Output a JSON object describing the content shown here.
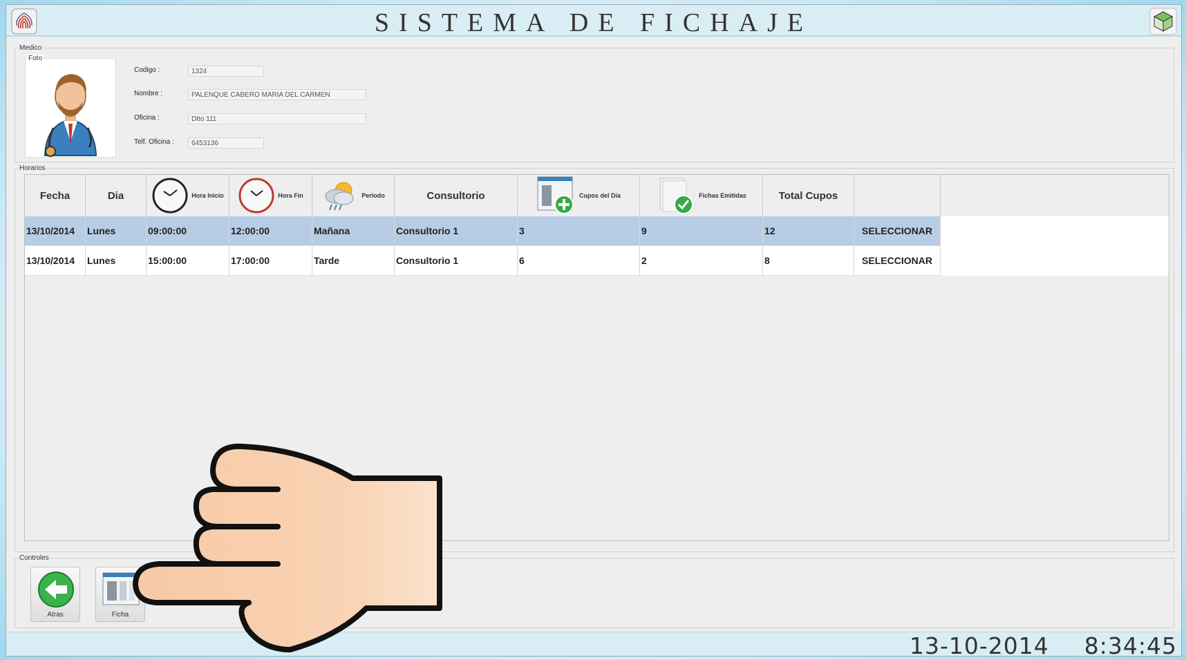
{
  "header": {
    "title": "SISTEMA DE FICHAJE",
    "left_logo_icon": "fingerprint-icon",
    "right_logo_icon": "cube-icon"
  },
  "medico": {
    "legend": "Medico",
    "photo_legend": "Foto",
    "photo_icon": "doctor-avatar-icon",
    "fields": [
      {
        "label": "Codigo :",
        "value": "1324"
      },
      {
        "label": "Nombre :",
        "value": "PALENQUE CABERO MARIA DEL CARMEN"
      },
      {
        "label": "Oficina :",
        "value": "Dtto 111"
      },
      {
        "label": "Telf. Oficina :",
        "value": "6453136"
      }
    ]
  },
  "horarios": {
    "legend": "Horarios",
    "columns": [
      {
        "label": "Fecha"
      },
      {
        "label": "Dia"
      },
      {
        "label": "Hora Inicio",
        "icon": "clock-icon"
      },
      {
        "label": "Hora Fin",
        "icon": "red-clock-icon"
      },
      {
        "label": "Periodo",
        "icon": "weather-icon"
      },
      {
        "label": "Consultorio"
      },
      {
        "label": "Cupos del Dia",
        "icon": "add-window-icon"
      },
      {
        "label": "Fichas Emitidas",
        "icon": "check-document-icon"
      },
      {
        "label": "Total Cupos"
      },
      {
        "label": ""
      }
    ],
    "rows": [
      {
        "fecha": "13/10/2014",
        "dia": "Lunes",
        "hora_inicio": "09:00:00",
        "hora_fin": "12:00:00",
        "periodo": "Mañana",
        "consultorio": "Consultorio 1",
        "cupos_dia": "3",
        "fichas_emitidas": "9",
        "total_cupos": "12",
        "action": "SELECCIONAR",
        "selected": true
      },
      {
        "fecha": "13/10/2014",
        "dia": "Lunes",
        "hora_inicio": "15:00:00",
        "hora_fin": "17:00:00",
        "periodo": "Tarde",
        "consultorio": "Consultorio 1",
        "cupos_dia": "6",
        "fichas_emitidas": "2",
        "total_cupos": "8",
        "action": "SELECCIONAR",
        "selected": false
      }
    ]
  },
  "controles": {
    "legend": "Controles",
    "buttons": [
      {
        "label": "Atras",
        "icon": "back-arrow-icon"
      },
      {
        "label": "Ficha",
        "icon": "window-icon"
      }
    ]
  },
  "status": {
    "date": "13-10-2014",
    "time": "8:34:45"
  },
  "overlay": {
    "icon": "pointing-hand-icon"
  }
}
